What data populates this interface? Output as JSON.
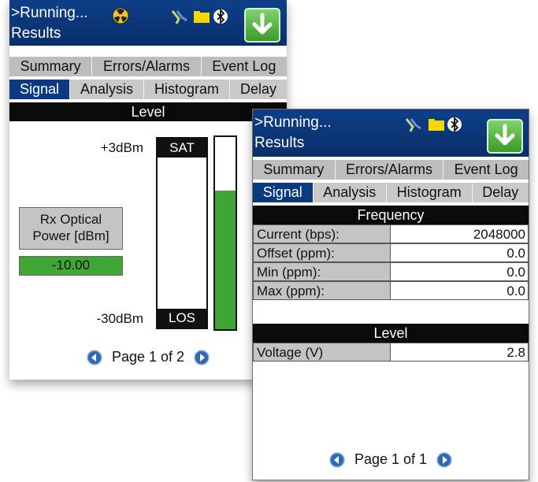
{
  "screen1": {
    "title_line1": ">Running...",
    "title_line2": "Results",
    "tabs_row1": [
      "Summary",
      "Errors/Alarms",
      "Event Log"
    ],
    "tabs_row2": [
      "Signal",
      "Analysis",
      "Histogram",
      "Delay"
    ],
    "active_tab": "Signal",
    "section_title": "Level",
    "scale_top": "+3dBm",
    "scale_bottom": "-30dBm",
    "meter_top_tag": "SAT",
    "meter_bottom_tag": "LOS",
    "level_fraction": 0.72,
    "rx_label_line1": "Rx Optical",
    "rx_label_line2": "Power [dBm]",
    "rx_value": "-10.00",
    "pager": "Page 1 of 2"
  },
  "screen2": {
    "title_line1": ">Running...",
    "title_line2": "Results",
    "tabs_row1": [
      "Summary",
      "Errors/Alarms",
      "Event Log"
    ],
    "tabs_row2": [
      "Signal",
      "Analysis",
      "Histogram",
      "Delay"
    ],
    "active_tab": "Signal",
    "frequency_title": "Frequency",
    "frequency_rows": [
      {
        "label": "Current (bps):",
        "value": "2048000"
      },
      {
        "label": "Offset (ppm):",
        "value": "0.0"
      },
      {
        "label": "Min (ppm):",
        "value": "0.0"
      },
      {
        "label": "Max (ppm):",
        "value": "0.0"
      }
    ],
    "level_title": "Level",
    "level_rows": [
      {
        "label": "Voltage (V)",
        "value": "2.8"
      }
    ],
    "pager": "Page 1 of 1"
  },
  "colors": {
    "titlebar": "#0b3a80",
    "active_tab": "#0b3a80",
    "level_green": "#3fa535",
    "download_button": "#4fb23a"
  },
  "icons": [
    "hazard-icon",
    "test-leads-icon",
    "folder-icon",
    "bluetooth-icon",
    "download-arrow-icon",
    "page-prev-icon",
    "page-next-icon"
  ]
}
